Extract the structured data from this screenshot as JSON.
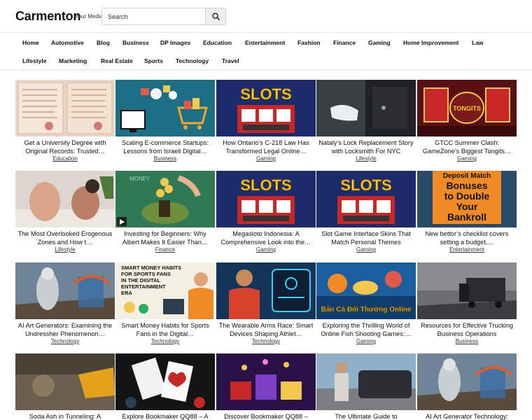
{
  "site": {
    "logo": "Carmenton",
    "tagline": "Your Media"
  },
  "search": {
    "placeholder": "Search",
    "icon": "search-icon"
  },
  "nav": {
    "row1": [
      "Home",
      "Automotive",
      "Blog",
      "Business",
      "DP Images",
      "Education",
      "Entertainment",
      "Fashion",
      "Finance",
      "Gaming",
      "Home Improvement",
      "Law"
    ],
    "row2": [
      "Lifestyle",
      "Marketing",
      "Real Estate",
      "Sports",
      "Technology",
      "Travel"
    ]
  },
  "posts": [
    {
      "title": "Get a University Degree with Original Records: Trusted…",
      "category": "Education"
    },
    {
      "title": "Scaling E-commerce Startups: Lessons from Israeli Digital…",
      "category": "Business"
    },
    {
      "title": "How Ontario’s C-218 Law Has Transformed Legal Online…",
      "category": "Gaming"
    },
    {
      "title": "Nataly’s Lock Replacement Story with Locksmith For NYC",
      "category": "Lifestyle"
    },
    {
      "title": "GTCC Summer Clash: GameZone’s Biggest Tongits…",
      "category": "Gaming"
    },
    {
      "title": "The Most Overlooked Erogenous Zones and How t…",
      "category": "Lifestyle"
    },
    {
      "title": "Investing for Beginners: Why Albert Makes It Easier Than…",
      "category": "Finance"
    },
    {
      "title": "Megasloto Indonesia: A Comprehensive Look into the…",
      "category": "Gaming"
    },
    {
      "title": "Slot Game Interface Skins That Match Personal Themes",
      "category": "Gaming"
    },
    {
      "title": "New bettor’s checklist covers setting a budget,…",
      "category": "Entertainment"
    },
    {
      "title": "AI Art Generators: Examining the Undressher Phenomenon…",
      "category": "Technology"
    },
    {
      "title": "Smart Money Habits for Sports Fans in the Digital…",
      "category": "Technology"
    },
    {
      "title": "The Wearable Arms Race: Smart Devices Shaping Athlet…",
      "category": "Technology"
    },
    {
      "title": "Exploring the Thrilling World of Online Fish Shooting Games:…",
      "category": "Gaming"
    },
    {
      "title": "Resources for Effective Trucking Business Operations",
      "category": "Business"
    },
    {
      "title": "Soda Ash in Tunneling: A",
      "category": ""
    },
    {
      "title": "Explore Bookmaker QQ88 – A",
      "category": ""
    },
    {
      "title": "Discover Bookmaker QQ88 –",
      "category": ""
    },
    {
      "title": "The Ultimate Guide to",
      "category": ""
    },
    {
      "title": "AI Art Generator Technology:",
      "category": ""
    }
  ],
  "thumb_text": {
    "slots": "SLOTS",
    "tongits": "TONGITS",
    "deposit": [
      "Deposit Match",
      "Bonuses",
      "to Double",
      "Your",
      "Bankroll"
    ],
    "smart_money": [
      "SMART MONEY HABITS",
      "FOR SPORTS FANS",
      "IN THE DIGITAL",
      "ENTERTAINMENT",
      "ERA"
    ],
    "fish": "Bắn Cá Đổi Thưởng Online",
    "money_tree": "MONEY"
  },
  "colors": {
    "accent": "#111111",
    "nav_border": "#e6e6e6",
    "search_btn": "#eeeeee"
  }
}
